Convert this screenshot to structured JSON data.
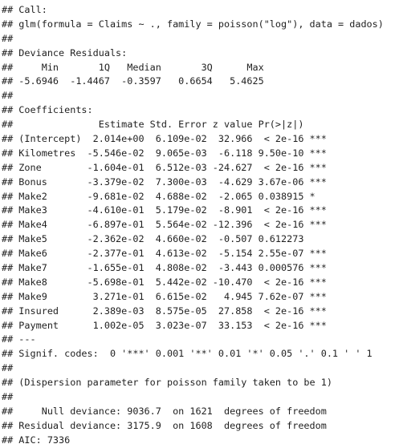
{
  "console": {
    "lines": [
      "## Call:",
      "## glm(formula = Claims ~ ., family = poisson(\"log\"), data = dados)",
      "##",
      "## Deviance Residuals:",
      "##     Min       1Q   Median       3Q      Max",
      "## -5.6946  -1.4467  -0.3597   0.6654   5.4625",
      "##",
      "## Coefficients:",
      "##               Estimate Std. Error z value Pr(>|z|)",
      "## (Intercept)  2.014e+00  6.109e-02  32.966  < 2e-16 ***",
      "## Kilometres  -5.546e-02  9.065e-03  -6.118 9.50e-10 ***",
      "## Zone        -1.604e-01  6.512e-03 -24.627  < 2e-16 ***",
      "## Bonus       -3.379e-02  7.300e-03  -4.629 3.67e-06 ***",
      "## Make2       -9.681e-02  4.688e-02  -2.065 0.038915 *",
      "## Make3       -4.610e-01  5.179e-02  -8.901  < 2e-16 ***",
      "## Make4       -6.897e-01  5.564e-02 -12.396  < 2e-16 ***",
      "## Make5       -2.362e-02  4.660e-02  -0.507 0.612273",
      "## Make6       -2.377e-01  4.613e-02  -5.154 2.55e-07 ***",
      "## Make7       -1.655e-01  4.808e-02  -3.443 0.000576 ***",
      "## Make8       -5.698e-01  5.442e-02 -10.470  < 2e-16 ***",
      "## Make9        3.271e-01  6.615e-02   4.945 7.62e-07 ***",
      "## Insured      2.389e-03  8.575e-05  27.858  < 2e-16 ***",
      "## Payment      1.002e-05  3.023e-07  33.153  < 2e-16 ***",
      "## ---",
      "## Signif. codes:  0 '***' 0.001 '**' 0.01 '*' 0.05 '.' 0.1 ' ' 1",
      "##",
      "## (Dispersion parameter for poisson family taken to be 1)",
      "##",
      "##     Null deviance: 9036.7  on 1621  degrees of freedom",
      "## Residual deviance: 3175.9  on 1608  degrees of freedom",
      "## AIC: 7336"
    ]
  }
}
